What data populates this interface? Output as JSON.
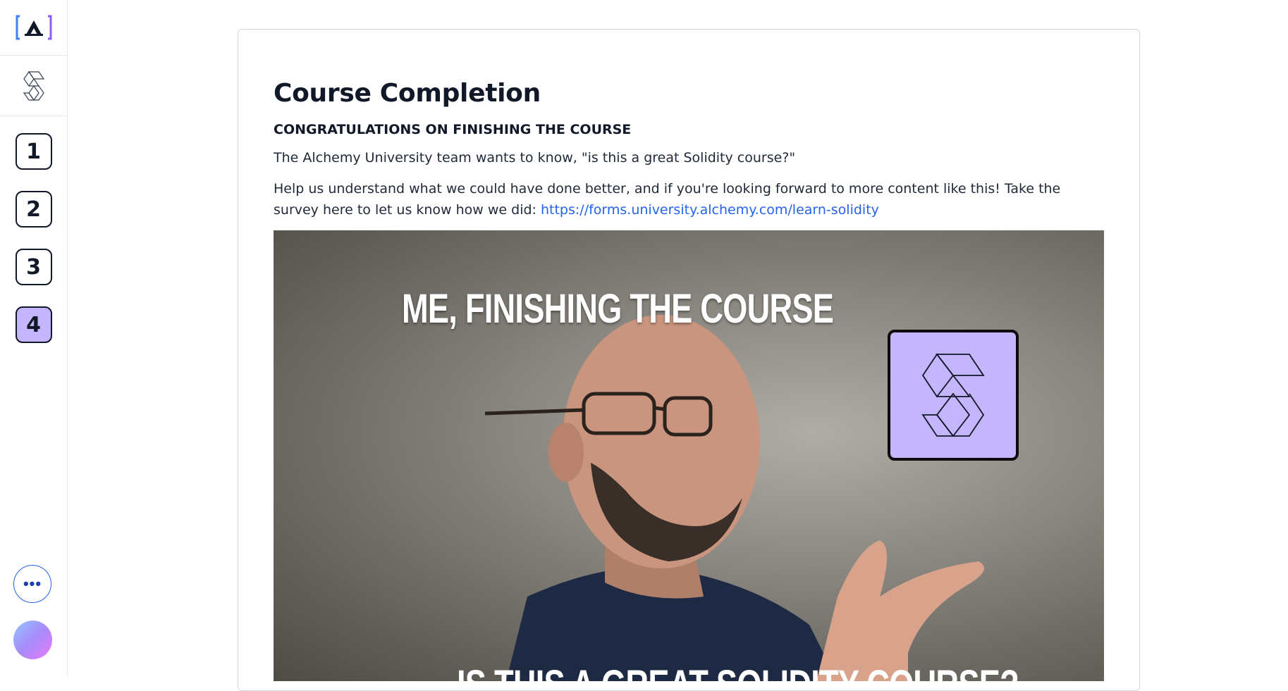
{
  "sidebar": {
    "logo_text": "[A]",
    "steps": [
      {
        "label": "1",
        "active": false
      },
      {
        "label": "2",
        "active": false
      },
      {
        "label": "3",
        "active": false
      },
      {
        "label": "4",
        "active": true
      }
    ],
    "more_label": "•••"
  },
  "main": {
    "title": "Course Completion",
    "subtitle": "CONGRATULATIONS ON FINISHING THE COURSE",
    "paragraph1": "The Alchemy University team wants to know, \"is this a great Solidity course?\"",
    "paragraph2": "Help us understand what we could have done better, and if you're looking forward to more content like this! Take the survey here to let us know how we did: ",
    "survey_link": "https://forms.university.alchemy.com/learn-solidity"
  },
  "video": {
    "caption_top": "ME, FINISHING THE COURSE",
    "caption_bottom": "IS THIS A GREAT SOLIDITY COURSE?"
  },
  "colors": {
    "accent": "#c4b5fd",
    "link": "#2563eb"
  }
}
